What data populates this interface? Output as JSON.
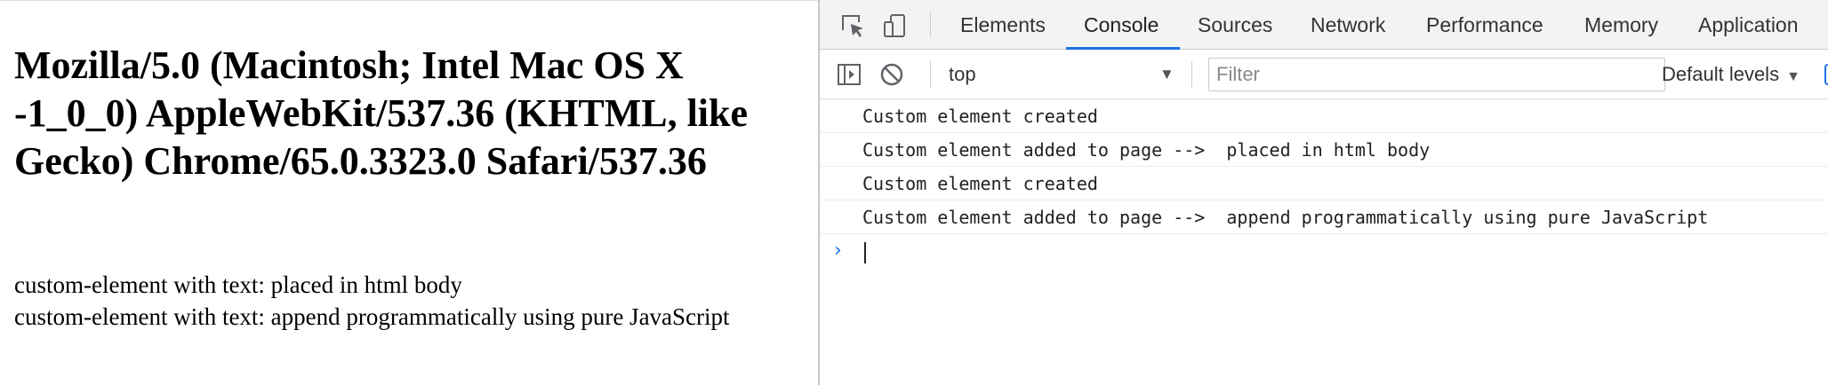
{
  "page": {
    "heading": "Mozilla/5.0 (Macintosh; Intel Mac OS X -1_0_0) AppleWebKit/537.36 (KHTML, like Gecko) Chrome/65.0.3323.0 Safari/537.36",
    "lines": [
      "custom-element with text: placed in html body",
      "custom-element with text: append programmatically using pure JavaScript"
    ]
  },
  "devtools": {
    "icons": {
      "inspect": "inspect-element-icon",
      "device": "device-toolbar-icon",
      "sidebar": "console-sidebar-icon",
      "clear": "clear-console-icon",
      "dropdown": "chevron-down-icon",
      "prompt": "chevron-right-icon"
    },
    "tabs": [
      {
        "label": "Elements",
        "active": false
      },
      {
        "label": "Console",
        "active": true
      },
      {
        "label": "Sources",
        "active": false
      },
      {
        "label": "Network",
        "active": false
      },
      {
        "label": "Performance",
        "active": false
      },
      {
        "label": "Memory",
        "active": false
      },
      {
        "label": "Application",
        "active": false
      }
    ],
    "toolbar": {
      "context": "top",
      "filter_placeholder": "Filter",
      "levels": "Default levels"
    },
    "messages": [
      "Custom element created",
      "Custom element added to page -->  placed in html body",
      "Custom element created",
      "Custom element added to page -->  append programmatically using pure JavaScript"
    ],
    "colors": {
      "accent": "#1a73e8",
      "tabbar_bg": "#f3f3f3"
    }
  }
}
